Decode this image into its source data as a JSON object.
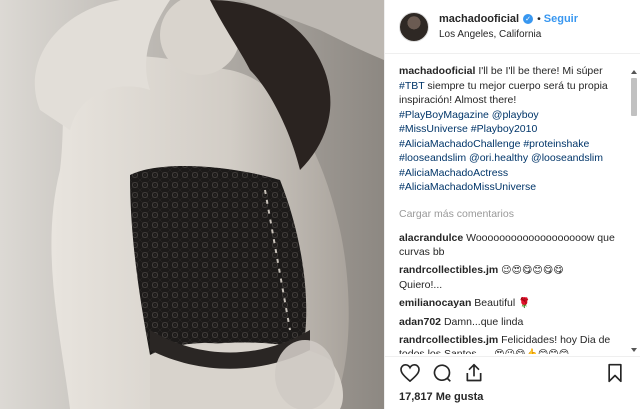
{
  "header": {
    "username": "machadooficial",
    "verified_mark": "✓",
    "separator": "•",
    "follow_label": "Seguir",
    "location": "Los Angeles, California"
  },
  "caption": {
    "username": "machadooficial",
    "text": "I'll be I'll be there! Mi súper",
    "line2_tag": "#TBT",
    "line2_text": " siempre tu mejor cuerpo será tu propia inspiración! Almost there!",
    "tags": [
      "#PlayBoyMagazine @playboy",
      "#MissUniverse #Playboy2010",
      "#AliciaMachadoChallenge #proteinshake",
      "#looseandslim @ori.healthy @looseandslim",
      "#AliciaMachadoActress",
      "#AliciaMachadoMissUniverse"
    ]
  },
  "load_more": "Cargar más comentarios",
  "comments": [
    {
      "user": "alacrandulce",
      "text": "Wooooooooooooooooooow que curvas bb",
      "emoji": ""
    },
    {
      "user": "randrcollectibles.jm",
      "text": "Quiero!...",
      "emoji": "😉😍😋😊😋😋"
    },
    {
      "user": "emilianocayan",
      "text": "Beautiful",
      "emoji": "🌹"
    },
    {
      "user": "adan702",
      "text": "Damn...que linda",
      "emoji": ""
    },
    {
      "user": "randrcollectibles.jm",
      "text": "Felicidades! hoy Dia de todos los Santos.....",
      "emoji": "😍😉😋👍😊😊😊"
    }
  ],
  "likes": {
    "count": "17,817",
    "label": "Me gusta"
  },
  "icons": {
    "like": "heart-icon",
    "comment": "comment-icon",
    "share": "share-icon",
    "save": "bookmark-icon"
  }
}
